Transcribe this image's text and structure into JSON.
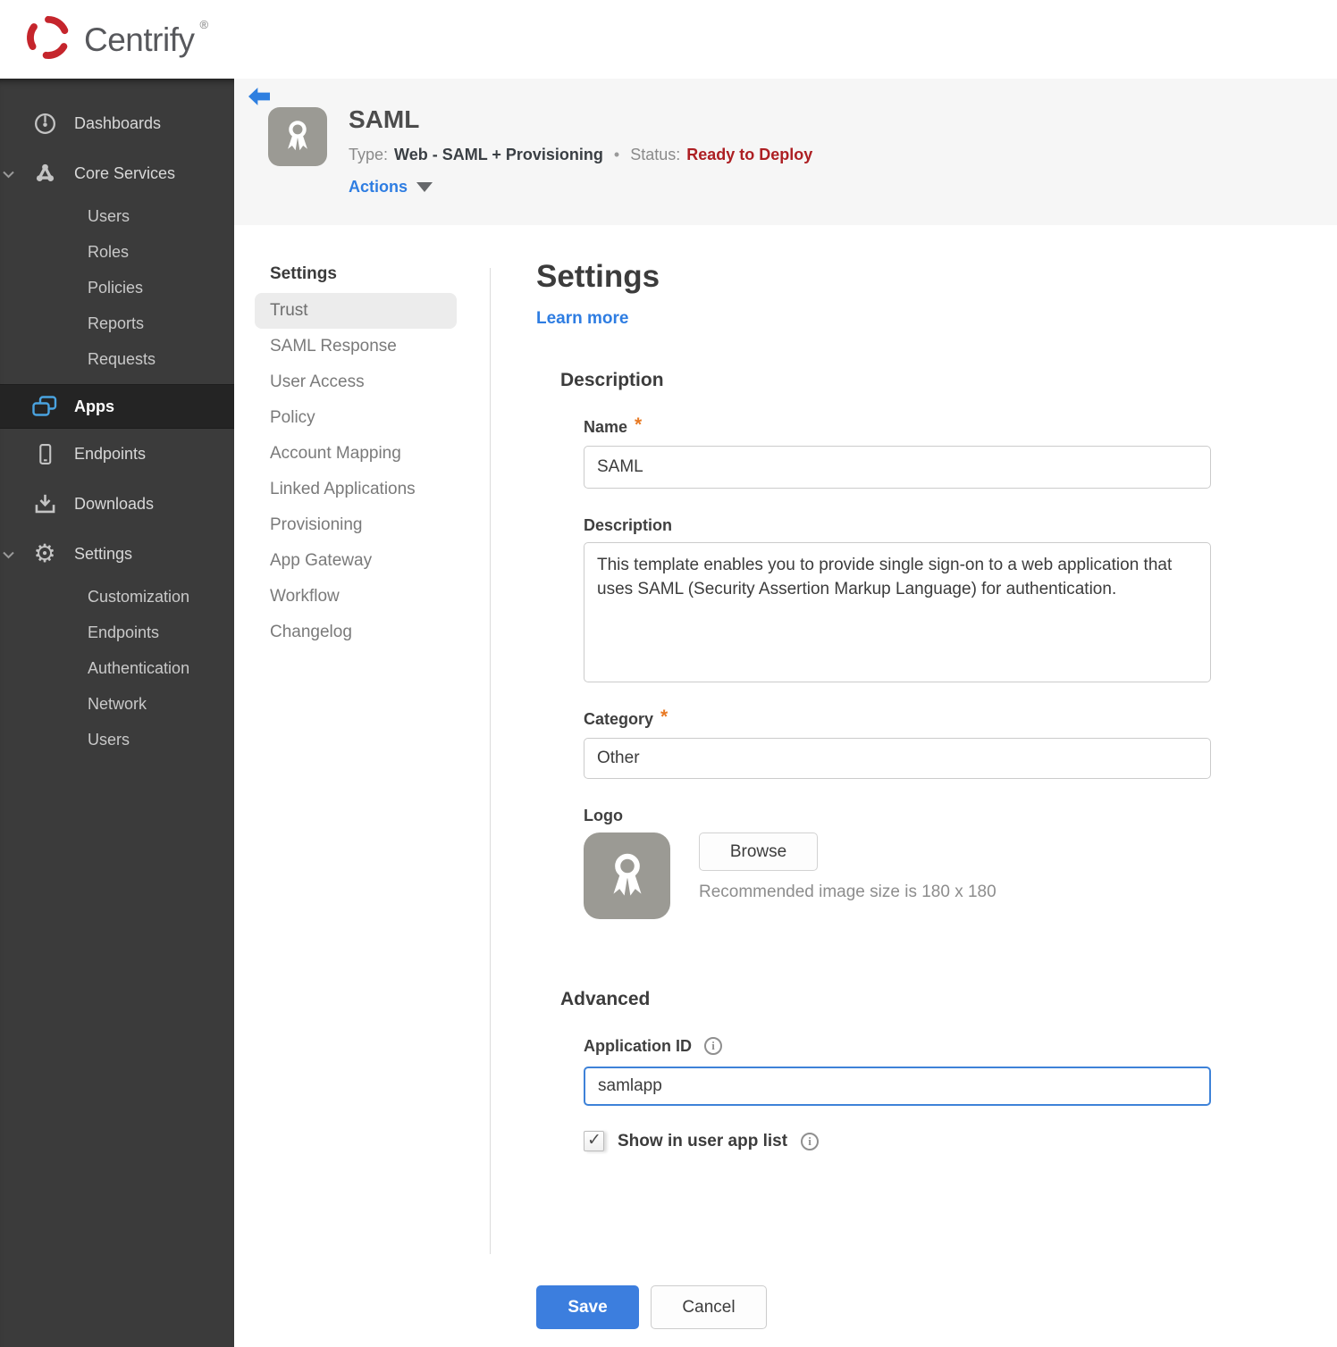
{
  "brand": {
    "name": "Centrify",
    "registered": "®"
  },
  "sidebar": {
    "dashboards": "Dashboards",
    "core_services": "Core Services",
    "core_children": [
      "Users",
      "Roles",
      "Policies",
      "Reports",
      "Requests"
    ],
    "apps": "Apps",
    "endpoints": "Endpoints",
    "downloads": "Downloads",
    "settings": "Settings",
    "settings_children": [
      "Customization",
      "Endpoints",
      "Authentication",
      "Network",
      "Users"
    ]
  },
  "header": {
    "title": "SAML",
    "type_label": "Type:",
    "type_value": "Web - SAML + Provisioning",
    "separator": "•",
    "status_label": "Status:",
    "status_value": "Ready to Deploy",
    "actions": "Actions"
  },
  "subnav": {
    "heading": "Settings",
    "selected": "Trust",
    "items": [
      "Trust",
      "SAML Response",
      "User Access",
      "Policy",
      "Account Mapping",
      "Linked Applications",
      "Provisioning",
      "App Gateway",
      "Workflow",
      "Changelog"
    ]
  },
  "main": {
    "title": "Settings",
    "learn_more": "Learn more",
    "required_marker": "*",
    "description": {
      "heading": "Description",
      "name_label": "Name",
      "name_value": "SAML",
      "description_label": "Description",
      "description_value": "This template enables you to provide single sign-on to a web application that uses SAML (Security Assertion Markup Language) for authentication.",
      "category_label": "Category",
      "category_value": "Other",
      "logo_label": "Logo",
      "browse_label": "Browse",
      "recommended_text": "Recommended image size is 180 x 180"
    },
    "advanced": {
      "heading": "Advanced",
      "application_id_label": "Application ID",
      "application_id_value": "samlapp",
      "show_in_user_app_list_label": "Show in user app list",
      "checked": true
    },
    "buttons": {
      "save": "Save",
      "cancel": "Cancel"
    }
  },
  "colors": {
    "brand_red": "#c5252c",
    "accent_blue": "#2e7de2",
    "save_blue": "#3c7ede",
    "status_red": "#ad1f23",
    "required_orange": "#e87a24",
    "apps_icon_blue": "#4aa3e0",
    "logo_gray": "#9b9a94",
    "sidebar_bg": "#3b3b3b",
    "sidebar_active_bg": "#242424",
    "header_band_bg": "#f6f6f6"
  }
}
